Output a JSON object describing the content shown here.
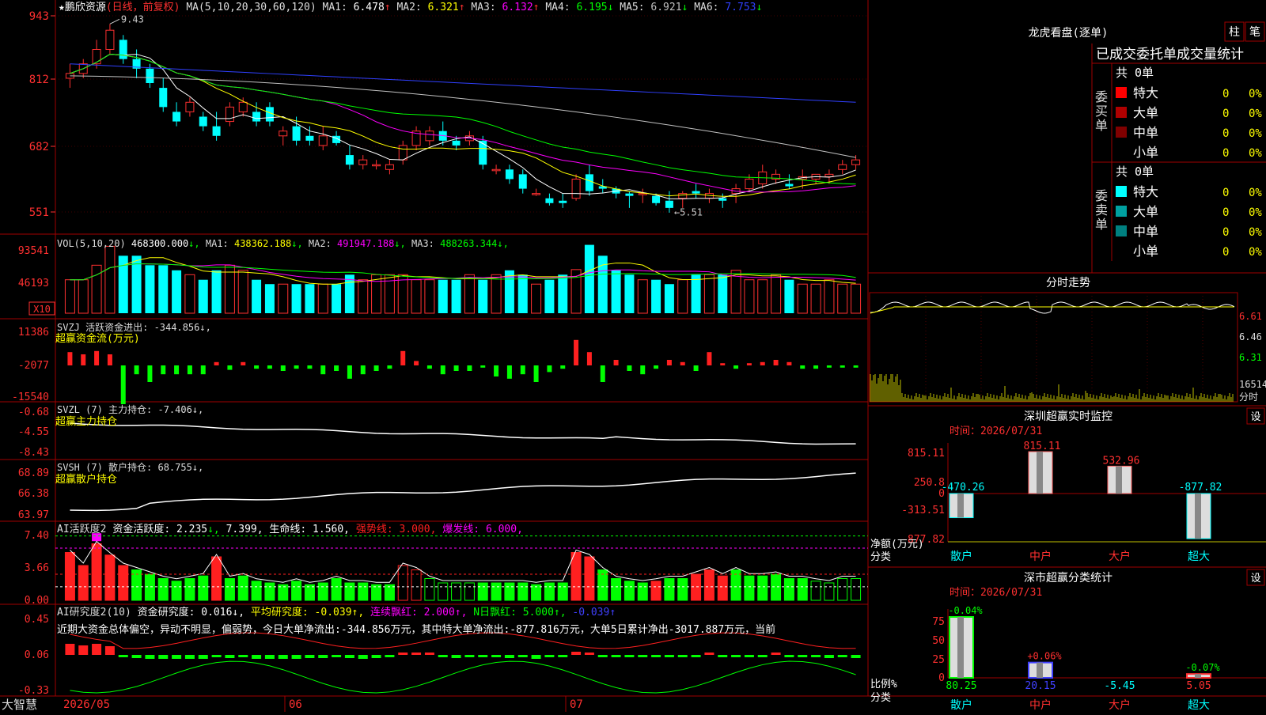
{
  "stock": {
    "name": "鹏欣资源",
    "period": "(日线，前复权)",
    "ma_label": "MA(5,10,20,30,60,120)"
  },
  "kline": {
    "ma_values": [
      {
        "label": "MA1:",
        "value": "6.478",
        "arrow": "↑",
        "color": "#ffffff"
      },
      {
        "label": "MA2:",
        "value": "6.321",
        "arrow": "↑",
        "color": "#ffff00"
      },
      {
        "label": "MA3:",
        "value": "6.132",
        "arrow": "↑",
        "color": "#ff00ff"
      },
      {
        "label": "MA4:",
        "value": "6.195",
        "arrow": "↓",
        "color": "#00ff00"
      },
      {
        "label": "MA5:",
        "value": "6.921",
        "arrow": "↓",
        "color": "#c0c0c0"
      },
      {
        "label": "MA6:",
        "value": "7.753",
        "arrow": "↓",
        "color": "#3040ff"
      }
    ],
    "y_ticks": [
      "943",
      "812",
      "682",
      "551"
    ],
    "high_marker": "9.43",
    "low_marker": "5.51"
  },
  "volume": {
    "label": "VOL(5,10,20)",
    "value": "468300.000",
    "arrow": "↓",
    "ma_values": [
      {
        "label": "MA1:",
        "value": "438362.188",
        "arrow": "↓",
        "color": "#ffff00"
      },
      {
        "label": "MA2:",
        "value": "491947.188",
        "arrow": "↓",
        "color": "#ff00ff"
      },
      {
        "label": "MA3:",
        "value": "488263.344",
        "arrow": "↓",
        "color": "#00ff00"
      }
    ],
    "y_ticks": [
      "93541",
      "46193"
    ],
    "unit_badge": "X10"
  },
  "svzj": {
    "label": "SVZJ",
    "desc": "活跃资金进出: -344.856↓,",
    "subtitle": "超赢资金流(万元)",
    "y_ticks": [
      "11386",
      "-2077",
      "-15540"
    ]
  },
  "svzl": {
    "label": "SVZL (7)",
    "desc": "主力持仓: -7.406↓,",
    "subtitle": "超赢主力持仓",
    "y_ticks": [
      "-0.68",
      "-4.55",
      "-8.43"
    ]
  },
  "svsh": {
    "label": "SVSH (7)",
    "desc": "散户持仓: 68.755↓,",
    "subtitle": "超赢散户持仓",
    "y_ticks": [
      "68.89",
      "66.38",
      "63.97"
    ]
  },
  "ai_active": {
    "label": "AI活跃度2",
    "t1": "资金活跃度: 2.235",
    "t1a": "↓,",
    "t2": "7.399,",
    "t3": "生命线: 1.560,",
    "t4": "强势线: 3.000,",
    "t5": "爆发线: 6.000,",
    "y_ticks": [
      "7.40",
      "3.66",
      "0.00"
    ]
  },
  "ai_research": {
    "label": "AI研究度2(10)",
    "t1": "资金研究度: 0.016↓,",
    "t2": "平均研究度: -0.039↑,",
    "t3": "连续飘红: 2.000↑,",
    "t4": "N日飘红: 5.000↑,",
    "t5": "-0.039↑",
    "comment": "近期大资金总体偏空，异动不明显，偏弱势，今日大单净流出:-344.856万元，其中特大单净流出:-877.816万元，大单5日累计净出-3017.887万元，当前",
    "y_ticks": [
      "0.45",
      "0.06",
      "-0.33"
    ]
  },
  "bottom_axis": {
    "brand": "大智慧",
    "dates": [
      "2026/05",
      "06",
      "07"
    ]
  },
  "right": {
    "dragon_title": "龙虎看盘(逐单)",
    "btn_zhu": "柱",
    "btn_bi": "笔",
    "stats_header": "已成交委托单成交量统计",
    "buy_group_label": "委买单",
    "buy_total": "共 0单",
    "sell_group_label": "委卖单",
    "sell_total": "共 0单",
    "buy_rows": [
      {
        "name": "特大",
        "count": "0",
        "pct": "0%",
        "color": "#ff0000"
      },
      {
        "name": "大单",
        "count": "0",
        "pct": "0%",
        "color": "#b00000"
      },
      {
        "name": "中单",
        "count": "0",
        "pct": "0%",
        "color": "#800000"
      },
      {
        "name": "小单",
        "count": "0",
        "pct": "0%",
        "color": ""
      }
    ],
    "sell_rows": [
      {
        "name": "特大",
        "count": "0",
        "pct": "0%",
        "color": "#00ffff"
      },
      {
        "name": "大单",
        "count": "0",
        "pct": "0%",
        "color": "#00a0a0"
      },
      {
        "name": "中单",
        "count": "0",
        "pct": "0%",
        "color": "#008080"
      },
      {
        "name": "小单",
        "count": "0",
        "pct": "0%",
        "color": ""
      }
    ],
    "intraday_title": "分时走势",
    "intraday_ticks": [
      "6.61",
      "6.46",
      "6.31",
      "16514"
    ],
    "intraday_unit": "分时",
    "sz_monitor": {
      "title": "深圳超赢实时监控",
      "time_label": "时间：2026/07/31",
      "settings": "设",
      "y_ticks": [
        "815.11",
        "250.8",
        "0",
        "-313.51",
        "-877.82"
      ],
      "axis_label1": "净额(万元)",
      "axis_label2": "分类",
      "categories": [
        "散户",
        "中户",
        "大户",
        "超大"
      ],
      "values": [
        -470.26,
        815.11,
        532.96,
        -877.82
      ],
      "value_labels": [
        "-470.26",
        "815.11",
        "532.96",
        "-877.82"
      ]
    },
    "sz_classify": {
      "title": "深市超赢分类统计",
      "time_label": "时间：2026/07/31",
      "settings": "设",
      "y_ticks": [
        "75",
        "50",
        "25",
        "0"
      ],
      "axis_label1": "比例%",
      "axis_label2": "分类",
      "categories": [
        "散户",
        "中户",
        "大户",
        "超大"
      ],
      "values": [
        80.25,
        20.15,
        -5.45,
        5.05
      ],
      "deltas": [
        "-0.04%",
        "+0.06%",
        "",
        "-0.07%"
      ],
      "value_labels": [
        "80.25",
        "20.15",
        "-5.45",
        "5.05"
      ]
    }
  },
  "chart_data": [
    {
      "type": "candlestick",
      "title": "鹏欣资源 (日线，前复权)",
      "x_range": [
        "2026/05",
        "07"
      ],
      "ylim": [
        5.51,
        9.43
      ],
      "ohlc": [
        [
          8.3,
          8.6,
          8.1,
          8.4
        ],
        [
          8.4,
          8.7,
          8.3,
          8.6
        ],
        [
          8.6,
          9.1,
          8.5,
          8.9
        ],
        [
          8.9,
          9.43,
          8.8,
          9.3
        ],
        [
          9.1,
          9.2,
          8.6,
          8.7
        ],
        [
          8.7,
          8.9,
          8.3,
          8.5
        ],
        [
          8.5,
          8.6,
          8.1,
          8.2
        ],
        [
          8.1,
          8.3,
          7.6,
          7.7
        ],
        [
          7.6,
          7.8,
          7.3,
          7.4
        ],
        [
          7.6,
          7.9,
          7.5,
          7.8
        ],
        [
          7.5,
          7.6,
          7.2,
          7.3
        ],
        [
          7.3,
          7.6,
          7.0,
          7.1
        ],
        [
          7.4,
          7.8,
          7.3,
          7.7
        ],
        [
          7.6,
          7.9,
          7.5,
          7.8
        ],
        [
          7.6,
          7.8,
          7.3,
          7.4
        ],
        [
          7.7,
          7.8,
          7.3,
          7.4
        ],
        [
          7.1,
          7.3,
          6.9,
          7.2
        ],
        [
          7.3,
          7.5,
          6.9,
          7.0
        ],
        [
          7.1,
          7.3,
          6.9,
          7.0
        ],
        [
          6.9,
          7.3,
          6.8,
          7.1
        ],
        [
          7.1,
          7.2,
          6.9,
          6.95
        ],
        [
          6.7,
          6.9,
          6.4,
          6.5
        ],
        [
          6.5,
          6.7,
          6.4,
          6.6
        ],
        [
          6.5,
          6.6,
          6.4,
          6.5
        ],
        [
          6.4,
          6.6,
          6.3,
          6.5
        ],
        [
          6.6,
          7.0,
          6.5,
          6.9
        ],
        [
          6.9,
          7.3,
          6.8,
          7.2
        ],
        [
          7.0,
          7.3,
          6.9,
          7.2
        ],
        [
          7.2,
          7.4,
          6.9,
          7.0
        ],
        [
          7.0,
          7.1,
          6.8,
          6.9
        ],
        [
          7.0,
          7.2,
          6.9,
          7.1
        ],
        [
          7.0,
          7.1,
          6.4,
          6.5
        ],
        [
          6.4,
          6.5,
          6.3,
          6.4
        ],
        [
          6.4,
          6.5,
          6.1,
          6.2
        ],
        [
          6.3,
          6.4,
          5.9,
          6.0
        ],
        [
          5.9,
          6.0,
          5.85,
          5.9
        ],
        [
          5.8,
          5.9,
          5.65,
          5.7
        ],
        [
          5.75,
          5.9,
          5.6,
          5.7
        ],
        [
          5.8,
          6.3,
          5.75,
          6.2
        ],
        [
          6.3,
          6.5,
          5.85,
          5.95
        ],
        [
          6.05,
          6.2,
          5.9,
          6.0
        ],
        [
          6.0,
          6.05,
          5.8,
          5.9
        ],
        [
          5.9,
          5.95,
          5.6,
          5.85
        ],
        [
          5.9,
          6.0,
          5.7,
          5.9
        ],
        [
          5.85,
          5.9,
          5.65,
          5.7
        ],
        [
          5.75,
          5.95,
          5.5,
          5.6
        ],
        [
          5.8,
          5.95,
          5.6,
          5.9
        ],
        [
          5.95,
          6.1,
          5.8,
          5.9
        ],
        [
          5.8,
          6.0,
          5.7,
          5.9
        ],
        [
          5.8,
          5.9,
          5.6,
          5.75
        ],
        [
          5.9,
          6.1,
          5.7,
          6.0
        ],
        [
          6.0,
          6.3,
          5.95,
          6.2
        ],
        [
          6.1,
          6.5,
          6.0,
          6.35
        ],
        [
          6.2,
          6.4,
          6.1,
          6.3
        ],
        [
          6.1,
          6.3,
          6.0,
          6.05
        ],
        [
          6.2,
          6.4,
          6.0,
          6.25
        ],
        [
          6.2,
          6.3,
          6.1,
          6.3
        ],
        [
          6.25,
          6.4,
          6.1,
          6.3
        ],
        [
          6.4,
          6.6,
          6.3,
          6.5
        ],
        [
          6.5,
          6.7,
          6.4,
          6.6
        ]
      ]
    },
    {
      "type": "bar",
      "title": "VOL(5,10,20)",
      "ylabel": "X10",
      "values": [
        46000,
        46000,
        66000,
        92000,
        79000,
        79000,
        66000,
        66000,
        59000,
        53000,
        46000,
        59000,
        66000,
        59000,
        46000,
        40000,
        40000,
        40000,
        40000,
        40000,
        40000,
        53000,
        46000,
        53000,
        53000,
        53000,
        46000,
        46000,
        46000,
        46000,
        53000,
        46000,
        53000,
        59000,
        53000,
        40000,
        46000,
        53000,
        60000,
        94000,
        79000,
        59000,
        53000,
        46000,
        46000,
        40000,
        46000,
        53000,
        53000,
        53000,
        59000,
        46000,
        46000,
        53000,
        46000,
        40000,
        40000,
        46000,
        40000,
        40000
      ],
      "ylim": [
        0,
        93541
      ]
    }
  ]
}
